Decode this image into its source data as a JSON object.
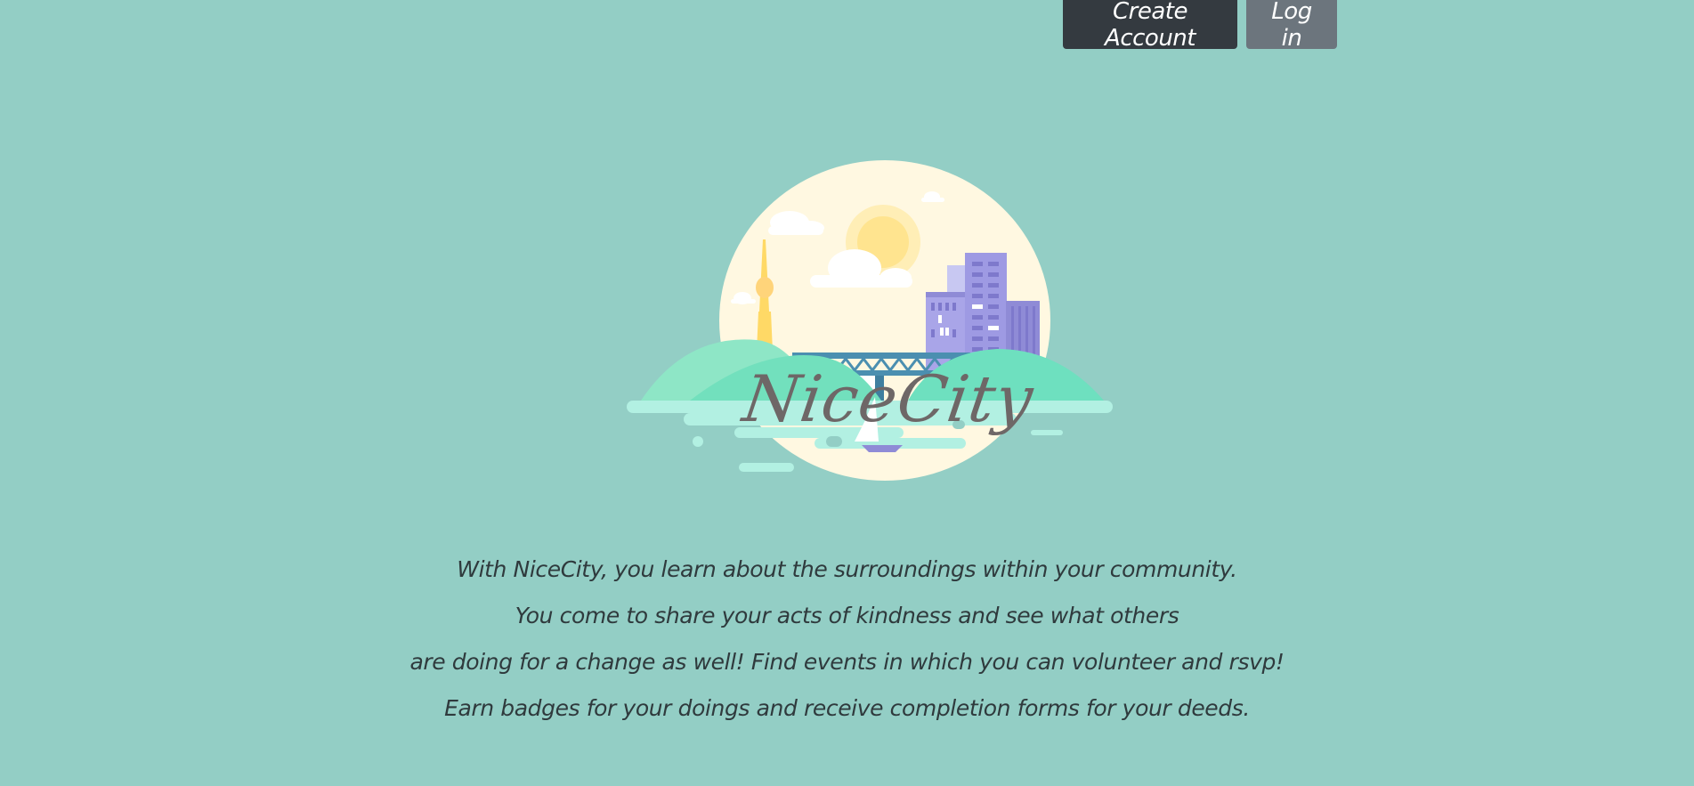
{
  "header": {
    "create_account_label": "Create Account",
    "login_label": "Log in"
  },
  "hero": {
    "logo_text": "NiceCity"
  },
  "description": {
    "lines": [
      "With NiceCity, you learn about the surroundings within your community.",
      "You come to share your acts of kindness and see what others",
      "are doing for a change as well! Find events in which you can volunteer and rsvp!",
      "Earn badges for your doings and receive completion forms for your deeds."
    ]
  },
  "colors": {
    "background": "#93cec5",
    "create_account_bg": "#343a40",
    "login_bg": "#6c757d",
    "logo_text": "#6e6767"
  }
}
